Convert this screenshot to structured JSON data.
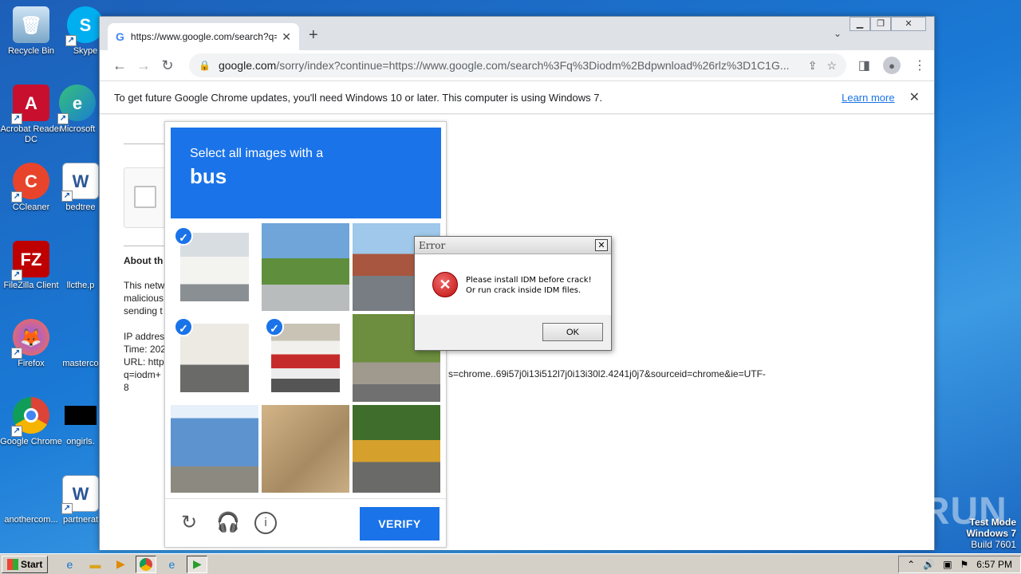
{
  "desktop": {
    "icons": [
      {
        "label": "Recycle Bin",
        "icon": "recycle-bin-icon"
      },
      {
        "label": "Skype",
        "icon": "skype-icon"
      },
      {
        "label": "Acrobat Reader DC",
        "icon": "acrobat-icon"
      },
      {
        "label": "Microsoft",
        "icon": "edge-icon"
      },
      {
        "label": "CCleaner",
        "icon": "ccleaner-icon"
      },
      {
        "label": "bedtree",
        "icon": "word-doc-icon"
      },
      {
        "label": "FileZilla Client",
        "icon": "filezilla-icon"
      },
      {
        "label": "llcthe.p",
        "icon": "blank-file-icon"
      },
      {
        "label": "Firefox",
        "icon": "firefox-icon"
      },
      {
        "label": "masterco",
        "icon": "blank-file-icon"
      },
      {
        "label": "Google Chrome",
        "icon": "chrome-icon"
      },
      {
        "label": "ongirls.",
        "icon": "black-file-icon"
      },
      {
        "label": "anothercom...",
        "icon": "blank-file-icon"
      },
      {
        "label": "partnerat",
        "icon": "word-doc-icon"
      }
    ]
  },
  "browser": {
    "tab_title": "https://www.google.com/search?q=",
    "tab_icon": "G",
    "new_tab": "+",
    "url_host": "google.com",
    "url_rest": "/sorry/index?continue=https://www.google.com/search%3Fq%3Diodm%2Bdpwnload%26rlz%3D1C1G...",
    "infobar_message": "To get future Google Chrome updates, you'll need Windows 10 or later. This computer is using Windows 7.",
    "infobar_link": "Learn more"
  },
  "page": {
    "about_heading": "About th",
    "para1": [
      "This netw",
      "malicious",
      "sending t"
    ],
    "para2": [
      "IP addres",
      "Time: 202",
      "URL: http",
      "q=iodm+",
      "8"
    ],
    "url_fragment": "s=chrome..69i57j0i13i512l7j0i13i30l2.4241j0j7&sourceid=chrome&ie=UTF-"
  },
  "captcha": {
    "prompt": "Select all images with a",
    "target": "bus",
    "verify_label": "VERIFY",
    "tiles": [
      {
        "desc": "bus-rear",
        "selected": true
      },
      {
        "desc": "highway-overpass",
        "selected": false
      },
      {
        "desc": "parking-lot",
        "selected": false
      },
      {
        "desc": "bus-front",
        "selected": true
      },
      {
        "desc": "red-bus",
        "selected": true
      },
      {
        "desc": "street-trees",
        "selected": false
      },
      {
        "desc": "road-intersection",
        "selected": false
      },
      {
        "desc": "blurred-street",
        "selected": false
      },
      {
        "desc": "school-bus",
        "selected": false
      }
    ]
  },
  "dialog": {
    "title": "Error",
    "line1": "Please install IDM before crack!",
    "line2": "Or run crack inside IDM files.",
    "ok_label": "OK"
  },
  "watermark": "ANY RUN",
  "test_mode": {
    "line1": "Test Mode",
    "line2": "Windows 7",
    "line3": "Build 7601"
  },
  "taskbar": {
    "start_label": "Start",
    "clock": "6:57 PM"
  }
}
